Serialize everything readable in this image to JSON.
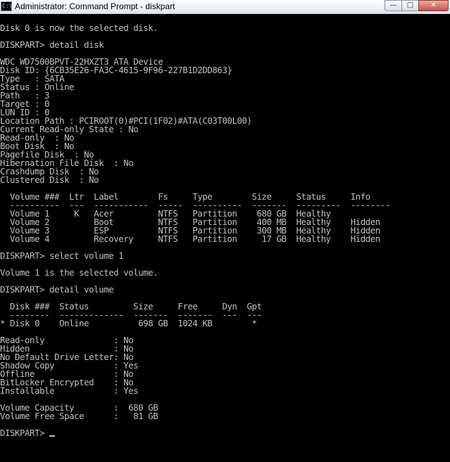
{
  "window": {
    "title": "Administrator: Command Prompt - diskpart",
    "icon_glyph": "C:\\",
    "icons": [
      "cmd-icon",
      "minimize-icon",
      "maximize-icon",
      "close-icon"
    ],
    "buttons": {
      "minimize": "—",
      "maximize": "□",
      "close": "✕"
    }
  },
  "console": {
    "lines": [
      "",
      "Disk 0 is now the selected disk.",
      "",
      "DISKPART> detail disk",
      "",
      "WDC WD7500BPVT-22HXZT3 ATA Device",
      "Disk ID: {6CB35E26-FA3C-4615-9F96-227B1D2DD863}",
      "Type   : SATA",
      "Status : Online",
      "Path   : 3",
      "Target : 0",
      "LUN ID : 0",
      "Location Path : PCIROOT(0)#PCI(1F02)#ATA(C03T00L00)",
      "Current Read-only State : No",
      "Read-only  : No",
      "Boot Disk  : No",
      "Pagefile Disk  : No",
      "Hibernation File Disk  : No",
      "Crashdump Disk  : No",
      "Clustered Disk  : No",
      "",
      "  Volume ###  Ltr  Label        Fs     Type        Size     Status     Info",
      "  ----------  ---  -----------  -----  ----------  -------  ---------  --------",
      "  Volume 1     K   Acer         NTFS   Partition    680 GB  Healthy",
      "  Volume 2         Boot         NTFS   Partition    400 MB  Healthy    Hidden",
      "  Volume 3         ESP          NTFS   Partition    300 MB  Healthy    Hidden",
      "  Volume 4         Recovery     NTFS   Partition     17 GB  Healthy    Hidden",
      "",
      "DISKPART> select volume 1",
      "",
      "Volume 1 is the selected volume.",
      "",
      "DISKPART> detail volume",
      "",
      "  Disk ###  Status         Size     Free     Dyn  Gpt",
      "  --------  -------------  -------  -------  ---  ---",
      "* Disk 0    Online          698 GB  1024 KB        *",
      "",
      "Read-only              : No",
      "Hidden                 : No",
      "No Default Drive Letter: No",
      "Shadow Copy            : Yes",
      "Offline                : No",
      "BitLocker Encrypted    : No",
      "Installable            : Yes",
      "",
      "Volume Capacity        :  680 GB",
      "Volume Free Space      :   81 GB",
      "",
      "DISKPART> "
    ]
  },
  "colors": {
    "text": "#c0c0c0",
    "background": "#000000"
  }
}
